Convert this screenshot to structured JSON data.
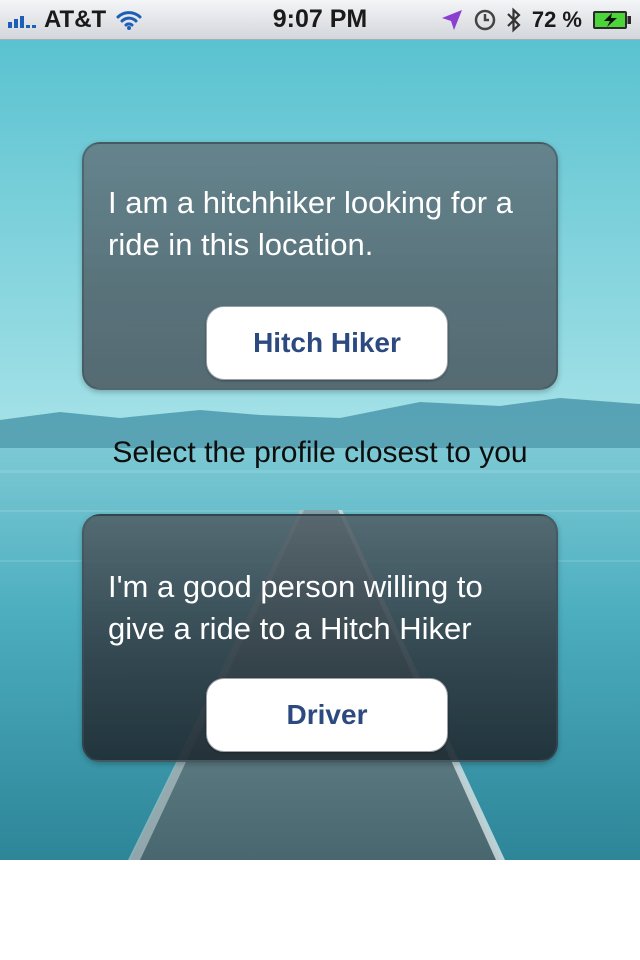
{
  "status_bar": {
    "carrier": "AT&T",
    "time": "9:07 PM",
    "battery_percent": "72 %",
    "icons": [
      "signal-icon",
      "wifi-icon",
      "location-arrow-icon",
      "alarm-clock-icon",
      "bluetooth-icon",
      "battery-charging-icon"
    ],
    "signal_bars": 3
  },
  "hitchhiker_card": {
    "description": "I am a hitchhiker looking for a ride in this location.",
    "button_label": "Hitch Hiker"
  },
  "prompt": "Select the profile closest to you",
  "driver_card": {
    "description": "I'm a good person willing to give a ride to a Hitch Hiker",
    "button_label": "Driver"
  },
  "colors": {
    "button_text": "#2c4a7f",
    "accent_signal": "#1d5fb7",
    "location_arrow": "#8a3fd1",
    "battery_fill": "#4cd43a"
  }
}
